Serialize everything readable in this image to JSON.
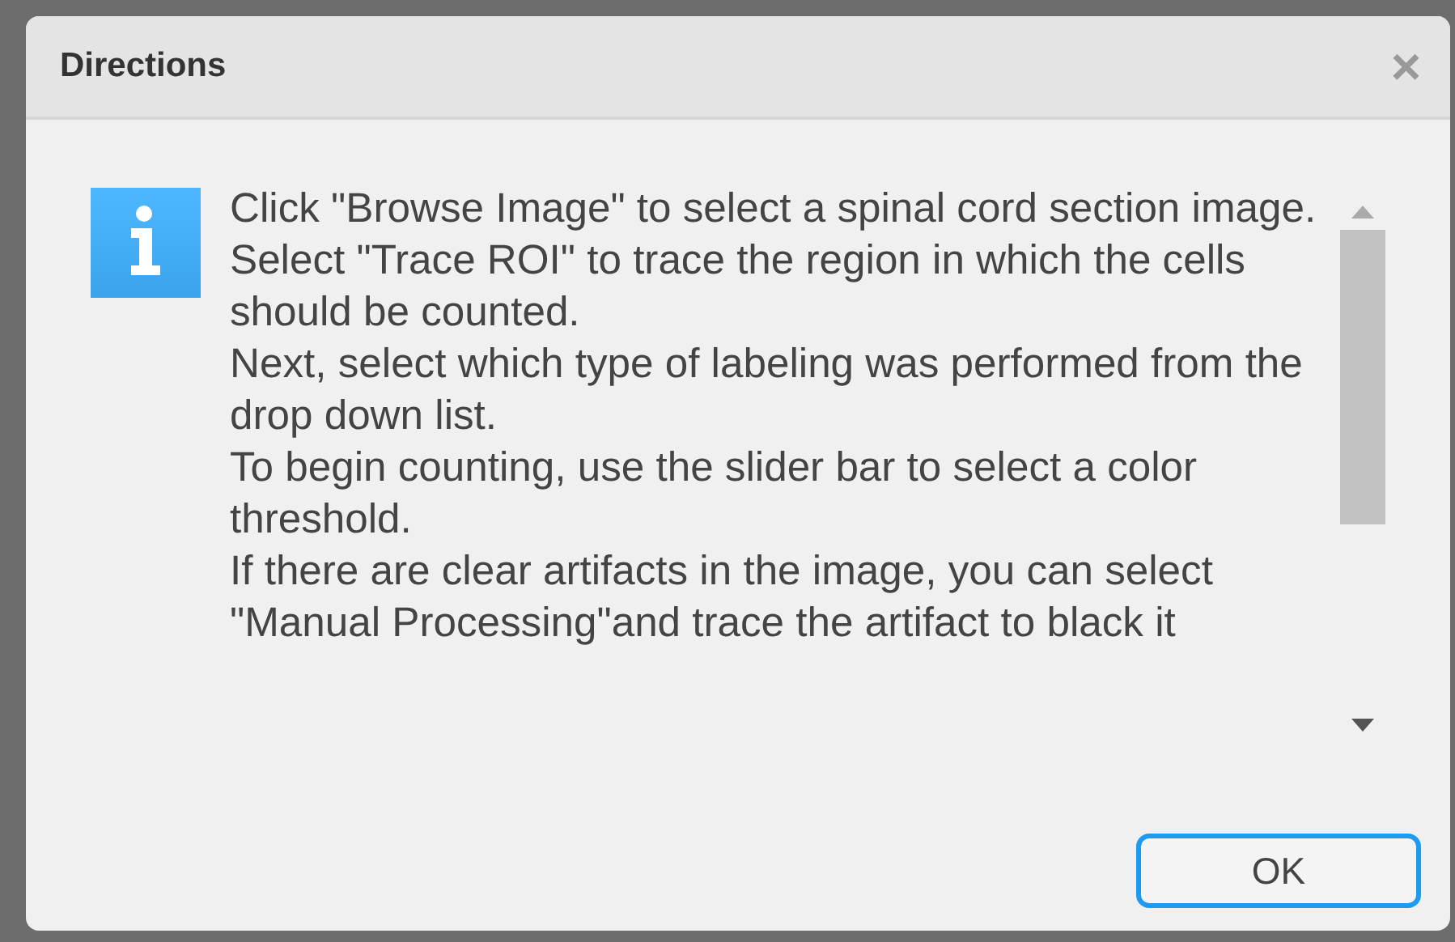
{
  "dialog": {
    "title": "Directions",
    "close": "×",
    "paragraphs": [
      "Click \"Browse Image\" to select a spinal cord section image.",
      "Select \"Trace ROI\" to trace the region in which the cells should be counted.",
      "Next, select which type of labeling was performed from the drop down list.",
      "To begin counting, use the slider bar to select a color threshold.",
      "If there are clear artifacts in the image, you can select \"Manual Processing\"and trace the artifact to black it"
    ],
    "buttons": [
      "OK"
    ]
  }
}
